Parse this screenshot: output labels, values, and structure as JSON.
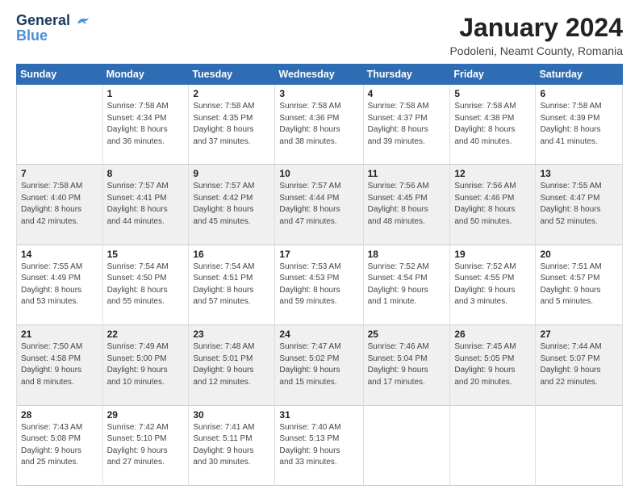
{
  "logo": {
    "line1": "General",
    "line2": "Blue"
  },
  "title": "January 2024",
  "subtitle": "Podoleni, Neamt County, Romania",
  "weekdays": [
    "Sunday",
    "Monday",
    "Tuesday",
    "Wednesday",
    "Thursday",
    "Friday",
    "Saturday"
  ],
  "weeks": [
    [
      {
        "day": "",
        "info": ""
      },
      {
        "day": "1",
        "info": "Sunrise: 7:58 AM\nSunset: 4:34 PM\nDaylight: 8 hours\nand 36 minutes."
      },
      {
        "day": "2",
        "info": "Sunrise: 7:58 AM\nSunset: 4:35 PM\nDaylight: 8 hours\nand 37 minutes."
      },
      {
        "day": "3",
        "info": "Sunrise: 7:58 AM\nSunset: 4:36 PM\nDaylight: 8 hours\nand 38 minutes."
      },
      {
        "day": "4",
        "info": "Sunrise: 7:58 AM\nSunset: 4:37 PM\nDaylight: 8 hours\nand 39 minutes."
      },
      {
        "day": "5",
        "info": "Sunrise: 7:58 AM\nSunset: 4:38 PM\nDaylight: 8 hours\nand 40 minutes."
      },
      {
        "day": "6",
        "info": "Sunrise: 7:58 AM\nSunset: 4:39 PM\nDaylight: 8 hours\nand 41 minutes."
      }
    ],
    [
      {
        "day": "7",
        "info": "Sunrise: 7:58 AM\nSunset: 4:40 PM\nDaylight: 8 hours\nand 42 minutes."
      },
      {
        "day": "8",
        "info": "Sunrise: 7:57 AM\nSunset: 4:41 PM\nDaylight: 8 hours\nand 44 minutes."
      },
      {
        "day": "9",
        "info": "Sunrise: 7:57 AM\nSunset: 4:42 PM\nDaylight: 8 hours\nand 45 minutes."
      },
      {
        "day": "10",
        "info": "Sunrise: 7:57 AM\nSunset: 4:44 PM\nDaylight: 8 hours\nand 47 minutes."
      },
      {
        "day": "11",
        "info": "Sunrise: 7:56 AM\nSunset: 4:45 PM\nDaylight: 8 hours\nand 48 minutes."
      },
      {
        "day": "12",
        "info": "Sunrise: 7:56 AM\nSunset: 4:46 PM\nDaylight: 8 hours\nand 50 minutes."
      },
      {
        "day": "13",
        "info": "Sunrise: 7:55 AM\nSunset: 4:47 PM\nDaylight: 8 hours\nand 52 minutes."
      }
    ],
    [
      {
        "day": "14",
        "info": "Sunrise: 7:55 AM\nSunset: 4:49 PM\nDaylight: 8 hours\nand 53 minutes."
      },
      {
        "day": "15",
        "info": "Sunrise: 7:54 AM\nSunset: 4:50 PM\nDaylight: 8 hours\nand 55 minutes."
      },
      {
        "day": "16",
        "info": "Sunrise: 7:54 AM\nSunset: 4:51 PM\nDaylight: 8 hours\nand 57 minutes."
      },
      {
        "day": "17",
        "info": "Sunrise: 7:53 AM\nSunset: 4:53 PM\nDaylight: 8 hours\nand 59 minutes."
      },
      {
        "day": "18",
        "info": "Sunrise: 7:52 AM\nSunset: 4:54 PM\nDaylight: 9 hours\nand 1 minute."
      },
      {
        "day": "19",
        "info": "Sunrise: 7:52 AM\nSunset: 4:55 PM\nDaylight: 9 hours\nand 3 minutes."
      },
      {
        "day": "20",
        "info": "Sunrise: 7:51 AM\nSunset: 4:57 PM\nDaylight: 9 hours\nand 5 minutes."
      }
    ],
    [
      {
        "day": "21",
        "info": "Sunrise: 7:50 AM\nSunset: 4:58 PM\nDaylight: 9 hours\nand 8 minutes."
      },
      {
        "day": "22",
        "info": "Sunrise: 7:49 AM\nSunset: 5:00 PM\nDaylight: 9 hours\nand 10 minutes."
      },
      {
        "day": "23",
        "info": "Sunrise: 7:48 AM\nSunset: 5:01 PM\nDaylight: 9 hours\nand 12 minutes."
      },
      {
        "day": "24",
        "info": "Sunrise: 7:47 AM\nSunset: 5:02 PM\nDaylight: 9 hours\nand 15 minutes."
      },
      {
        "day": "25",
        "info": "Sunrise: 7:46 AM\nSunset: 5:04 PM\nDaylight: 9 hours\nand 17 minutes."
      },
      {
        "day": "26",
        "info": "Sunrise: 7:45 AM\nSunset: 5:05 PM\nDaylight: 9 hours\nand 20 minutes."
      },
      {
        "day": "27",
        "info": "Sunrise: 7:44 AM\nSunset: 5:07 PM\nDaylight: 9 hours\nand 22 minutes."
      }
    ],
    [
      {
        "day": "28",
        "info": "Sunrise: 7:43 AM\nSunset: 5:08 PM\nDaylight: 9 hours\nand 25 minutes."
      },
      {
        "day": "29",
        "info": "Sunrise: 7:42 AM\nSunset: 5:10 PM\nDaylight: 9 hours\nand 27 minutes."
      },
      {
        "day": "30",
        "info": "Sunrise: 7:41 AM\nSunset: 5:11 PM\nDaylight: 9 hours\nand 30 minutes."
      },
      {
        "day": "31",
        "info": "Sunrise: 7:40 AM\nSunset: 5:13 PM\nDaylight: 9 hours\nand 33 minutes."
      },
      {
        "day": "",
        "info": ""
      },
      {
        "day": "",
        "info": ""
      },
      {
        "day": "",
        "info": ""
      }
    ]
  ]
}
